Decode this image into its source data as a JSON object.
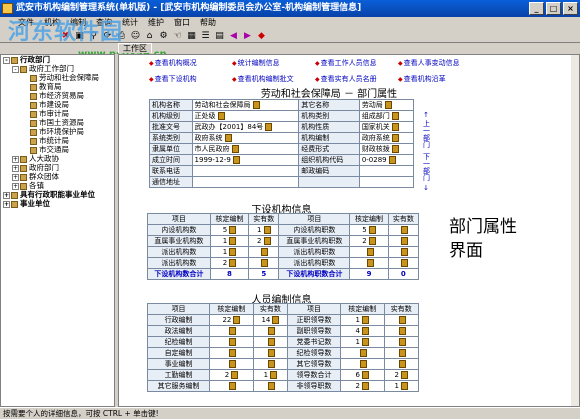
{
  "window": {
    "title": "武安市机构编制管理系统(单机版) - [武安市机构编制委员会办公室-机构编制管理信息]"
  },
  "menu": [
    "文件",
    "机构",
    "编制",
    "查询",
    "统计",
    "维护",
    "窗口",
    "帮助"
  ],
  "watermark": {
    "big": "河东软件园",
    "small": "www.pc0359.cn"
  },
  "tab": "工作区",
  "tree": [
    {
      "level": 0,
      "exp": "-",
      "label": "行政部门",
      "bold": true
    },
    {
      "level": 1,
      "exp": "-",
      "label": "政府工作部门"
    },
    {
      "level": 2,
      "exp": "",
      "label": "劳动和社会保障局"
    },
    {
      "level": 2,
      "exp": "",
      "label": "教育局"
    },
    {
      "level": 2,
      "exp": "",
      "label": "市经济贸易局"
    },
    {
      "level": 2,
      "exp": "",
      "label": "市建设局"
    },
    {
      "level": 2,
      "exp": "",
      "label": "市审计局"
    },
    {
      "level": 2,
      "exp": "",
      "label": "市国土资源局"
    },
    {
      "level": 2,
      "exp": "",
      "label": "市环境保护局"
    },
    {
      "level": 2,
      "exp": "",
      "label": "市统计局"
    },
    {
      "level": 2,
      "exp": "",
      "label": "市交通局"
    },
    {
      "level": 1,
      "exp": "+",
      "label": "人大政协"
    },
    {
      "level": 1,
      "exp": "+",
      "label": "政府部门"
    },
    {
      "level": 1,
      "exp": "+",
      "label": "群众团体"
    },
    {
      "level": 1,
      "exp": "+",
      "label": "各镇"
    },
    {
      "level": 0,
      "exp": "+",
      "label": "具有行政职能事业单位",
      "bold": true
    },
    {
      "level": 0,
      "exp": "+",
      "label": "事业单位",
      "bold": true
    }
  ],
  "links": [
    "查看机构概况",
    "统计编制信息",
    "查看工作人员信息",
    "查看人事变动信息",
    "查看下设机构",
    "查看机构编制批文",
    "查看实有人员名册",
    "查看机构沿革"
  ],
  "dept": {
    "title": "劳动和社会保障局 － 部门属性",
    "rows": [
      [
        "机构名称",
        "劳动和社会保障局",
        "其它名称",
        "劳动局"
      ],
      [
        "机构级别",
        "正处级",
        "机构类别",
        "组成部门"
      ],
      [
        "批准文号",
        "武政办【2001】84号",
        "机构性质",
        "国家机关"
      ],
      [
        "系统类别",
        "政府系统",
        "机构编制",
        "政府系统"
      ],
      [
        "隶属单位",
        "市人民政府",
        "经费形式",
        "财政核拨"
      ],
      [
        "成立时间",
        "1999-12-9",
        "组织机构代码",
        "0-0289"
      ],
      [
        "联系电话",
        "",
        "邮政编码",
        ""
      ],
      [
        "通信地址",
        "",
        "",
        ""
      ]
    ]
  },
  "sub": {
    "title": "下设机构信息",
    "head": [
      "项目",
      "核定编制",
      "实有数",
      "项目",
      "核定编制",
      "实有数"
    ],
    "rows": [
      [
        "内设机构数",
        "5",
        "1",
        "内设机构职数",
        "5",
        ""
      ],
      [
        "直属事业机构数",
        "1",
        "2",
        "直属事业机构职数",
        "2",
        ""
      ],
      [
        "派出机构数",
        "1",
        "",
        "派出机构职数",
        "",
        ""
      ],
      [
        "派出机构数",
        "2",
        "",
        "派出机构职数",
        "",
        ""
      ]
    ],
    "total": [
      "下设机构数合计",
      "8",
      "5",
      "下设机构职数合计",
      "9",
      "0"
    ]
  },
  "staff": {
    "title": "人员编制信息",
    "head": [
      "项目",
      "核定编制",
      "实有数",
      "项目",
      "核定编制",
      "实有数"
    ],
    "rows": [
      [
        "行政编制",
        "22",
        "14",
        "正职领导数",
        "1",
        ""
      ],
      [
        "政法编制",
        "",
        "",
        "副职领导数",
        "4",
        ""
      ],
      [
        "纪检编制",
        "",
        "",
        "党委书记数",
        "1",
        ""
      ],
      [
        "自定编制",
        "",
        "",
        "纪检领导数",
        "",
        ""
      ],
      [
        "事业编制",
        "",
        "",
        "其它领导数",
        "",
        ""
      ],
      [
        "工勤编制",
        "2",
        "1",
        "领导数合计",
        "6",
        "2"
      ],
      [
        "其它服务编制",
        "",
        "",
        "非领导职数",
        "2",
        "1"
      ]
    ]
  },
  "side_nav": {
    "prev": "上一部门",
    "next": "下一部门"
  },
  "caption": "部门属性界面",
  "status": "按需要个人的详细信息，可按 CTRL + 单击键!"
}
